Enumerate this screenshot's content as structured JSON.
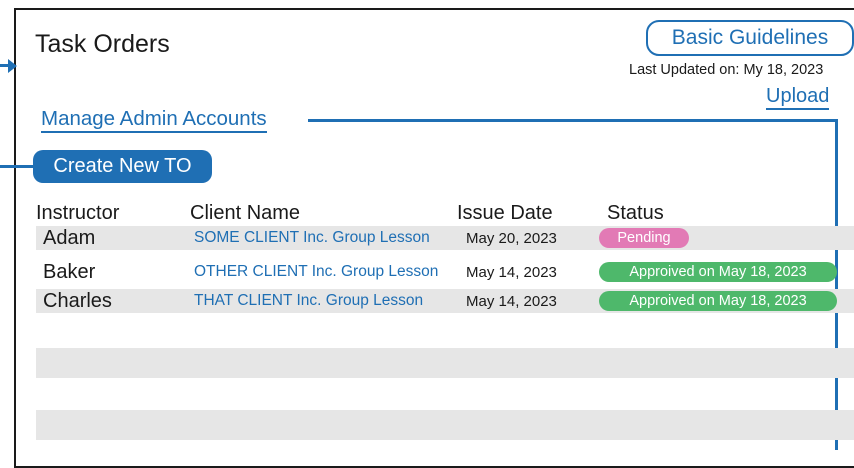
{
  "page": {
    "title": "Task Orders",
    "guidelines_label": "Basic Guidelines",
    "last_updated": "Last Updated on: My 18, 2023",
    "upload_label": "Upload",
    "manage_label": "Manage Admin Accounts",
    "create_label": "Create New TO"
  },
  "table": {
    "headers": {
      "instructor": "Instructor",
      "client": "Client Name",
      "issue_date": "Issue Date",
      "status": "Status"
    },
    "rows": [
      {
        "instructor": "Adam",
        "client": "SOME CLIENT Inc. Group Lesson",
        "issue_date": "May 20, 2023",
        "status": "Pending",
        "status_type": "pending"
      },
      {
        "instructor": "Baker",
        "client": "OTHER CLIENT Inc. Group Lesson",
        "issue_date": "May 14, 2023",
        "status": "Approived on May 18, 2023",
        "status_type": "approved"
      },
      {
        "instructor": "Charles",
        "client": "THAT CLIENT Inc. Group Lesson",
        "issue_date": "May 14, 2023",
        "status": "Approived on May 18, 2023",
        "status_type": "approved"
      }
    ]
  },
  "colors": {
    "accent": "#1f6fb4",
    "pending": "#e27ab5",
    "approved": "#4eb86b",
    "row_alt": "#e6e6e6"
  }
}
